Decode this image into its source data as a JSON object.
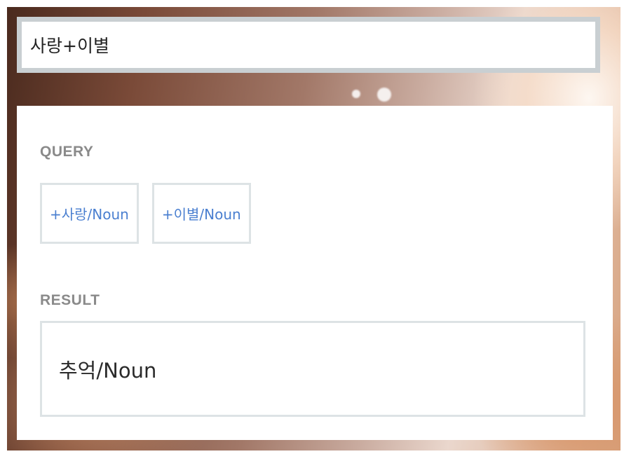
{
  "search": {
    "value": "사랑+이별"
  },
  "query": {
    "label": "QUERY",
    "tokens": [
      {
        "label": "+사랑/Noun"
      },
      {
        "label": "+이별/Noun"
      }
    ]
  },
  "result": {
    "label": "RESULT",
    "value": "추억/Noun"
  },
  "colors": {
    "token_text": "#4a7fd0",
    "section_label": "#8a8a8a",
    "border": "#dde3e5",
    "search_border": "#c9cfd2"
  }
}
